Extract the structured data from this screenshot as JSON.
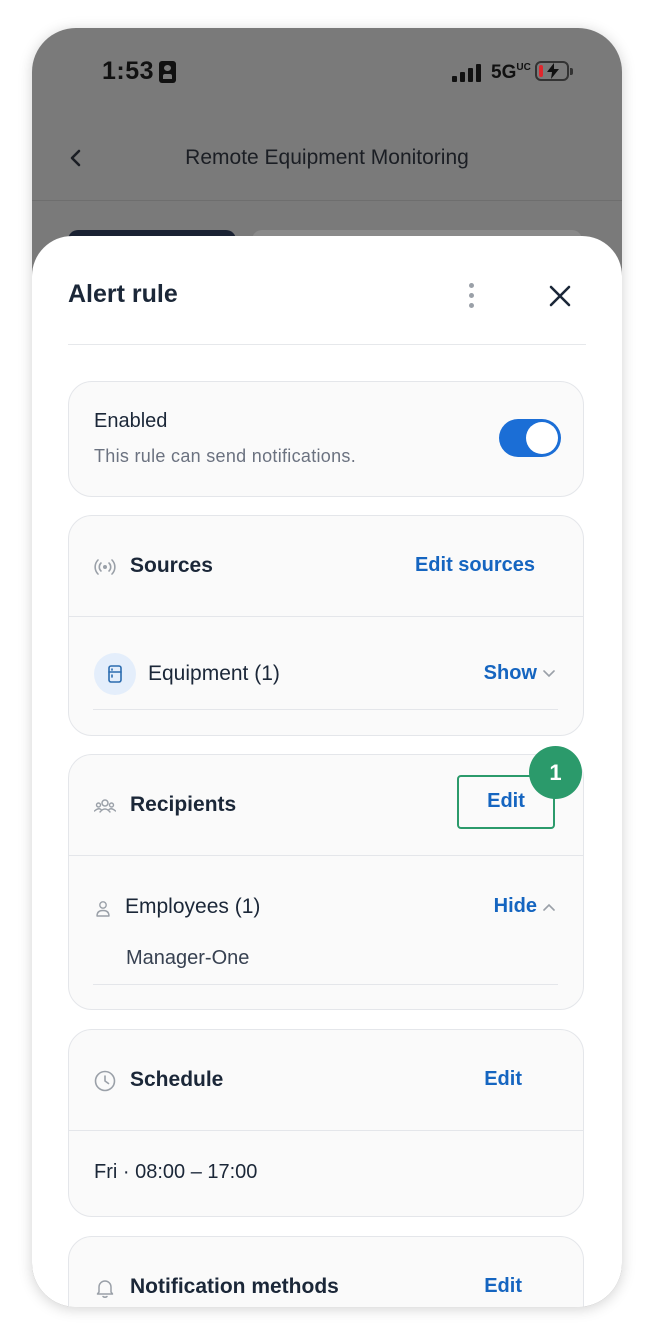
{
  "status_bar": {
    "time": "1:53",
    "network": "5G",
    "network_suffix": "UC"
  },
  "nav": {
    "title": "Remote Equipment Monitoring"
  },
  "sheet": {
    "title": "Alert rule"
  },
  "enabled": {
    "title": "Enabled",
    "description": "This rule can send notifications.",
    "toggle_on": true
  },
  "sources": {
    "title": "Sources",
    "action": "Edit sources",
    "item": "Equipment (1)",
    "item_action": "Show"
  },
  "recipients": {
    "title": "Recipients",
    "action": "Edit",
    "step_badge": "1",
    "group": "Employees (1)",
    "group_action": "Hide",
    "members": [
      "Manager-One"
    ]
  },
  "schedule": {
    "title": "Schedule",
    "action": "Edit",
    "value": "Fri · 08:00 – 17:00"
  },
  "notification_methods": {
    "title": "Notification methods",
    "action": "Edit"
  },
  "colors": {
    "accent": "#1565c0",
    "toggle": "#1b6ed6",
    "highlight": "#2b9a6b",
    "text": "#1b2738"
  }
}
